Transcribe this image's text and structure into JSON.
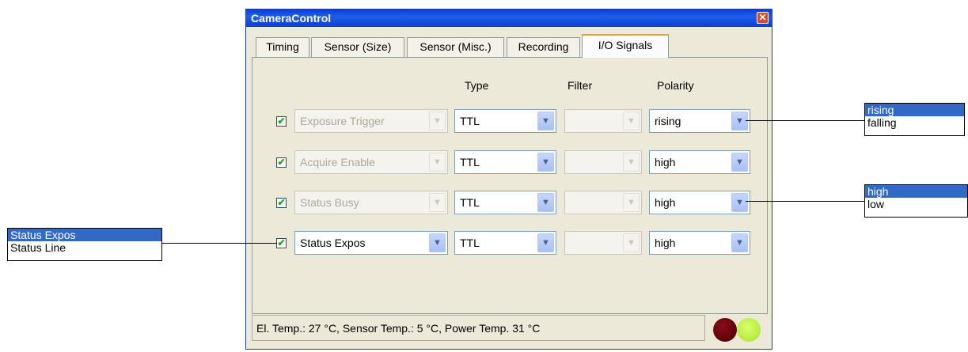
{
  "window": {
    "title": "CameraControl"
  },
  "tabs": [
    {
      "label": "Timing"
    },
    {
      "label": "Sensor (Size)"
    },
    {
      "label": "Sensor (Misc.)"
    },
    {
      "label": "Recording"
    },
    {
      "label": "I/O Signals",
      "active": true
    }
  ],
  "columns": {
    "type": "Type",
    "filter": "Filter",
    "polarity": "Polarity"
  },
  "rows": [
    {
      "checked": true,
      "signal": "Exposure Trigger",
      "signal_enabled": false,
      "type": "TTL",
      "filter": "",
      "polarity": "rising"
    },
    {
      "checked": true,
      "signal": "Acquire Enable",
      "signal_enabled": false,
      "type": "TTL",
      "filter": "",
      "polarity": "high"
    },
    {
      "checked": true,
      "signal": "Status Busy",
      "signal_enabled": false,
      "type": "TTL",
      "filter": "",
      "polarity": "high"
    },
    {
      "checked": true,
      "signal": "Status Expos",
      "signal_enabled": true,
      "type": "TTL",
      "filter": "",
      "polarity": "high"
    }
  ],
  "status": {
    "text": "El. Temp.: 27 °C, Sensor Temp.: 5 °C, Power Temp. 31 °C"
  },
  "popups": {
    "polarity_edge": [
      "rising",
      "falling"
    ],
    "polarity_level": [
      "high",
      "low"
    ],
    "status_signal": [
      "Status Expos",
      "Status Line"
    ]
  },
  "colors": {
    "title_bar": "#0a3fd6",
    "selection": "#316ac5",
    "led_red": "#6b0010",
    "led_green": "#b8f040"
  },
  "icons": {
    "close": "close-icon",
    "dropdown": "chevron-down-icon",
    "check": "checkmark-icon"
  }
}
